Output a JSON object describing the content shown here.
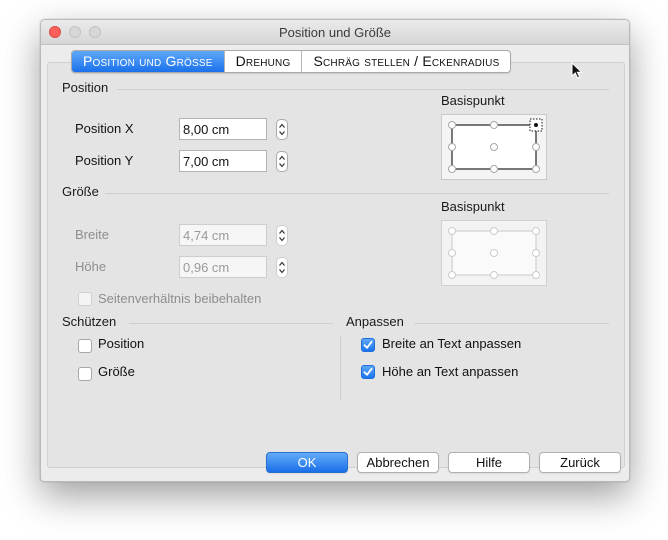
{
  "window": {
    "title": "Position und Größe"
  },
  "tabs": [
    {
      "label": "Position und Grösse",
      "active": true
    },
    {
      "label": "Drehung",
      "active": false
    },
    {
      "label": "Schräg stellen / Eckenradius",
      "active": false
    }
  ],
  "position_section": {
    "title": "Position",
    "fields": [
      {
        "label": "Position X",
        "value": "8,00 cm"
      },
      {
        "label": "Position Y",
        "value": "7,00 cm"
      }
    ],
    "basispunkt_label": "Basispunkt",
    "selected_point": "top-right"
  },
  "size_section": {
    "title": "Größe",
    "fields": [
      {
        "label": "Breite",
        "value": "4,74 cm",
        "disabled": true
      },
      {
        "label": "Höhe",
        "value": "0,96 cm",
        "disabled": true
      }
    ],
    "keep_ratio_label": "Seitenverhältnis beibehalten",
    "basispunkt_label": "Basispunkt",
    "disabled": true
  },
  "protect_section": {
    "title": "Schützen",
    "options": [
      {
        "label": "Position",
        "checked": false
      },
      {
        "label": "Größe",
        "checked": false
      }
    ]
  },
  "adapt_section": {
    "title": "Anpassen",
    "options": [
      {
        "label": "Breite an Text anpassen",
        "checked": true
      },
      {
        "label": "Höhe an Text anpassen",
        "checked": true
      }
    ]
  },
  "buttons": {
    "ok": "OK",
    "cancel": "Abbrechen",
    "help": "Hilfe",
    "back": "Zurück"
  },
  "colors": {
    "accent": "#1b71ec",
    "close": "#fc605b"
  }
}
